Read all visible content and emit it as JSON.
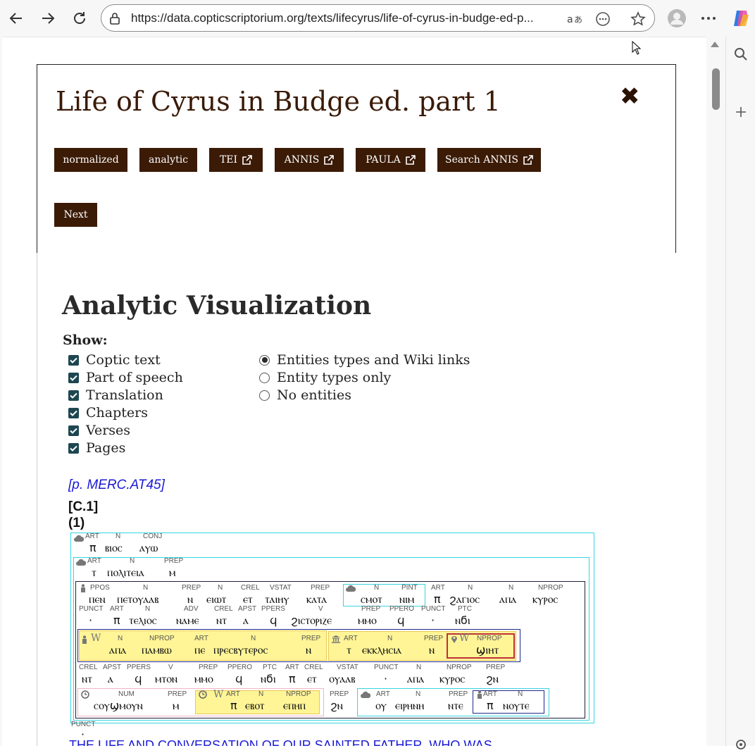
{
  "browser": {
    "url": "https://data.copticscriptorium.org/texts/lifecyrus/life-of-cyrus-in-budge-ed-p...",
    "icons": [
      "back-icon",
      "forward-icon",
      "refresh-icon",
      "lock-icon",
      "read-aloud-icon",
      "more-options-icon",
      "favorite-star-icon",
      "profile-avatar",
      "menu-dots-icon",
      "copilot-icon",
      "search-icon",
      "add-icon",
      "settings-icon"
    ]
  },
  "doc": {
    "title": "Life of Cyrus in Budge ed. part 1",
    "close_glyph": "✖",
    "buttons": [
      {
        "label": "normalized"
      },
      {
        "label": "analytic"
      },
      {
        "label": "TEI"
      },
      {
        "label": "ANNIS"
      },
      {
        "label": "PAULA"
      },
      {
        "label": "Search ANNIS"
      }
    ],
    "next_label": "Next"
  },
  "viz": {
    "title": "Analytic Visualization",
    "show_label": "Show:",
    "checkboxes": [
      "Coptic text",
      "Part of speech",
      "Translation",
      "Chapters",
      "Verses",
      "Pages"
    ],
    "radios": [
      "Entities types and Wiki links",
      "Entity types only",
      "No entities"
    ],
    "selected_radio": "Entities types and Wiki links",
    "page_ref": "[p. MERC.AT45]",
    "chapter": "[C.1]",
    "verse": "(1)"
  },
  "lines": {
    "l1": {
      "tok": [
        "π",
        "ⲃⲓⲟⲥ",
        "ⲁⲩⲱ"
      ],
      "pos": [
        "ART",
        "N",
        "CONJ"
      ]
    },
    "l2": {
      "tok": [
        "ⲧ",
        "ⲡⲟⲗⲓⲧⲉⲓⲁ",
        "ⲙ"
      ],
      "pos": [
        "ART",
        "N",
        "PREP"
      ]
    },
    "l3": {
      "tok": [
        "ⲡⲉⲛ",
        "ⲡⲉⲧⲟⲩⲁⲁⲃ",
        "ⲛ",
        "ⲉⲓⲱⲧ",
        "ⲉⲧ",
        "ⲧⲁⲓⲏⲩ",
        "ⲕⲁⲧⲁ",
        "ⲥⲙⲟⲧ",
        "ⲛⲓⲙ",
        "π",
        "ϩⲁⲅⲓⲟⲥ",
        "ⲁⲡⲁ",
        "ⲕⲩⲣⲟⲥ"
      ],
      "pos": [
        "PPOS",
        "N",
        "PREP",
        "N",
        "CREL",
        "VSTAT",
        "PREP",
        "N",
        "PINT",
        "ART",
        "N",
        "N",
        "NPROP"
      ]
    },
    "l4": {
      "tok": [
        "·",
        "π",
        "ⲧⲉⲗⲓⲟⲥ",
        "ⲛⲁⲙⲉ",
        "ⲛⲧ",
        "ⲁ",
        "ϥ",
        "ϩⲓⲥⲧⲟⲣⲓⲍⲉ",
        "ⲙⲙⲟ",
        "ϥ",
        "·",
        "ⲛϭⲓ"
      ],
      "pos": [
        "PUNCT",
        "ART",
        "N",
        "ADV",
        "CREL",
        "APST",
        "PPERS",
        "V",
        "PREP",
        "PPERO",
        "PUNCT",
        "PTC"
      ]
    },
    "l5": {
      "tok": [
        "ⲁⲡⲁ",
        "ⲡⲁⲙⲃⲱ",
        "ⲡⲉ",
        "ⲡⲣⲉⲥⲃⲩⲧⲉⲣⲟⲥ",
        "ⲛ",
        "ⲧ",
        "ⲉⲕⲕⲗⲏⲥⲓⲁ",
        "ⲛ",
        "ϣⲓⲏⲧ"
      ],
      "pos": [
        "N",
        "NPROP",
        "ART",
        "N",
        "PREP",
        "ART",
        "N",
        "PREP",
        "NPROP"
      ]
    },
    "l6": {
      "tok": [
        "ⲛⲧ",
        "ⲁ",
        "ϥ",
        "ⲙⲧⲟⲛ",
        "ⲙⲙⲟ",
        "ϥ",
        "ⲛϭⲓ",
        "π",
        "ⲉⲧ",
        "ⲟⲩⲁⲁⲃ",
        "·",
        "ⲁⲡⲁ",
        "ⲕⲩⲣⲟⲥ",
        "ϩⲛ"
      ],
      "pos": [
        "CREL",
        "APST",
        "PPERS",
        "V",
        "PREP",
        "PPERO",
        "PTC",
        "ART",
        "CREL",
        "VSTAT",
        "PUNCT",
        "N",
        "NPROP",
        "PREP"
      ]
    },
    "l7": {
      "tok": [
        "ⲥⲟⲩϣⲙⲟⲩⲛ",
        "ⲙ",
        "π",
        "ⲉⲃⲟⲧ",
        "ⲉⲡⲏⲡ",
        "ϩⲛ",
        "ⲟⲩ",
        "ⲉⲓⲣⲏⲛⲏ",
        "ⲛⲧⲉ",
        "π",
        "ⲛⲟⲩⲧⲉ"
      ],
      "pos": [
        "NUM",
        "PREP",
        "ART",
        "N",
        "NPROP",
        "PREP",
        "ART",
        "N",
        "PREP",
        "ART",
        "N"
      ]
    },
    "l8": {
      "tok": [
        "·"
      ],
      "pos": [
        "PUNCT"
      ]
    }
  },
  "translation_cut": "THE LIFE AND CONVERSATION OF OUR SAINTED FATHER, WHO WAS"
}
